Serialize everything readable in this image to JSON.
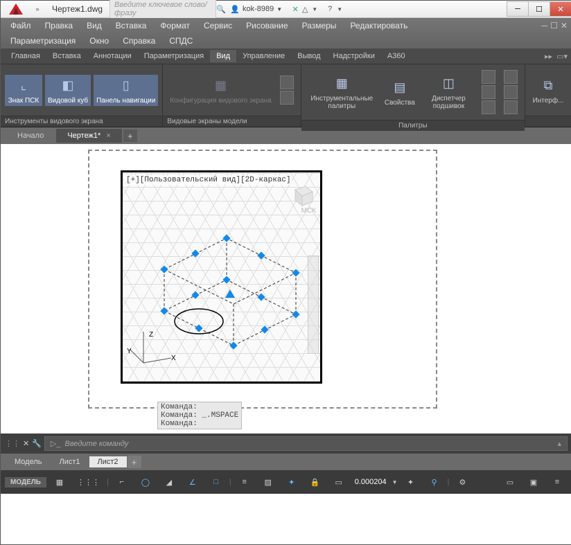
{
  "title": "Чертеж1.dwg",
  "search_placeholder": "Введите ключевое слово/фразу",
  "user": "kok-8989",
  "menubar": [
    "Файл",
    "Правка",
    "Вид",
    "Вставка",
    "Формат",
    "Сервис",
    "Рисование",
    "Размеры",
    "Редактировать",
    "Параметризация",
    "Окно",
    "Справка",
    "СПДС"
  ],
  "ribbon_tabs": [
    "Главная",
    "Вставка",
    "Аннотации",
    "Параметризация",
    "Вид",
    "Управление",
    "Вывод",
    "Надстройки",
    "A360"
  ],
  "active_rtab": 4,
  "panels": {
    "p1": {
      "label": "Инструменты видового экрана",
      "btns": [
        {
          "t": "Знак ПСК"
        },
        {
          "t": "Видовой куб"
        },
        {
          "t": "Панель навигации"
        }
      ]
    },
    "p2": {
      "label": "Видовые экраны модели",
      "btns": [
        {
          "t": "Конфигурация видового экрана"
        }
      ]
    },
    "p3": {
      "label": "Палитры",
      "btns": [
        {
          "t": "Инструментальные палитры"
        },
        {
          "t": "Свойства"
        },
        {
          "t": "Диспетчер подшивок"
        }
      ]
    },
    "p4": {
      "label": "",
      "btns": [
        {
          "t": "Интерф..."
        }
      ]
    }
  },
  "doctabs": [
    {
      "t": "Начало"
    },
    {
      "t": "Чертеж1*"
    }
  ],
  "active_doc": 1,
  "viewport_label": "[+][Пользовательский вид][2D-каркас]",
  "viewport_cube": "МСК",
  "ucs": {
    "x": "X",
    "y": "Y",
    "z": "Z"
  },
  "cmd_history": [
    "Команда:",
    "Команда: _.MSPACE",
    "Команда:"
  ],
  "cmd_placeholder": "Введите команду",
  "layout_tabs": [
    "Модель",
    "Лист1",
    "Лист2"
  ],
  "active_layout": 2,
  "status": {
    "model": "МОДЕЛЬ",
    "coord": "0.000204"
  }
}
